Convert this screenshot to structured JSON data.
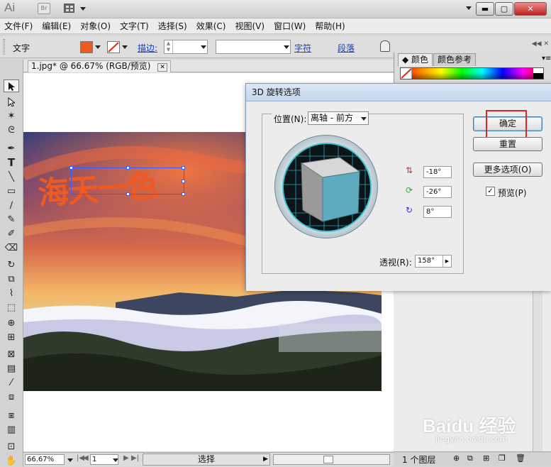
{
  "titlebar": {
    "app_logo": "Ai",
    "bridge_label": "Br",
    "icons": [
      "arrange-documents-icon",
      "dropdown-arrow-icon"
    ],
    "window_controls": [
      "minimize-icon",
      "restore-icon",
      "close-icon"
    ]
  },
  "menubar": {
    "items": [
      "文件(F)",
      "编辑(E)",
      "对象(O)",
      "文字(T)",
      "选择(S)",
      "效果(C)",
      "视图(V)",
      "窗口(W)",
      "帮助(H)"
    ]
  },
  "controlbar": {
    "mode_label": "文字",
    "fill_color": "#ee5a22",
    "stroke_label": "描边:",
    "character_link": "字符",
    "paragraph_link": "段落"
  },
  "document": {
    "tab_title": "1.jpg* @ 66.67% (RGB/预览)",
    "artwork_text": "海天一色"
  },
  "statusbar": {
    "zoom": "66.67%",
    "page": "1",
    "status_text": "选择"
  },
  "color_panel": {
    "tabs": [
      "颜色",
      "颜色参考"
    ]
  },
  "layers_panel": {
    "count_label": "1 个图层"
  },
  "dialog": {
    "title": "3D 旋转选项",
    "position_label": "位置(N):",
    "position_value": "离轴 - 前方",
    "rotate_x": "-18°",
    "rotate_y": "-26°",
    "rotate_z": "8°",
    "perspective_label": "透视(R):",
    "perspective_value": "158°",
    "ok_button": "确定",
    "reset_button": "重置",
    "more_options_button": "更多选项(O)",
    "preview_label": "预览(P)",
    "preview_checked": true,
    "highlight_color": "#e0242c"
  },
  "watermark": {
    "brand": "Baidu 经验",
    "url": "jingyan.baidu.com"
  }
}
